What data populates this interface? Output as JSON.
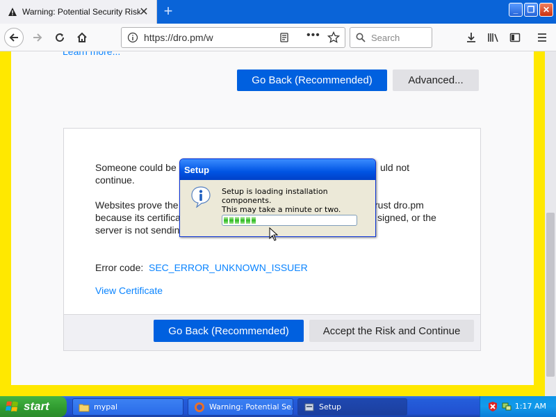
{
  "browser": {
    "tab": {
      "title": "Warning: Potential Security Risk A"
    },
    "url": "https://dro.pm/w",
    "search_placeholder": "Search"
  },
  "page": {
    "learn_more": "Learn more...",
    "go_back_top": "Go Back (Recommended)",
    "advanced": "Advanced...",
    "para1_a": "Someone could be",
    "para1_b": "uld not",
    "para1_c": "continue.",
    "para2_a": "Websites prove the",
    "para2_b": "rust dro.pm",
    "para2_c": "because its certifica",
    "para2_d": "signed, or the",
    "para2_e": "server is not sendin",
    "error_label": "Error code: ",
    "error_code": "SEC_ERROR_UNKNOWN_ISSUER",
    "view_cert": "View Certificate",
    "go_back_bottom": "Go Back (Recommended)",
    "accept": "Accept the Risk and Continue"
  },
  "dialog": {
    "title": "Setup",
    "line1": "Setup is loading installation components.",
    "line2": "This may take a minute or two.",
    "progress_blocks": 6
  },
  "taskbar": {
    "start": "start",
    "tasks": [
      {
        "label": "mypal"
      },
      {
        "label": "Warning: Potential Se..."
      },
      {
        "label": "Setup"
      }
    ],
    "clock": "1:17 AM"
  }
}
